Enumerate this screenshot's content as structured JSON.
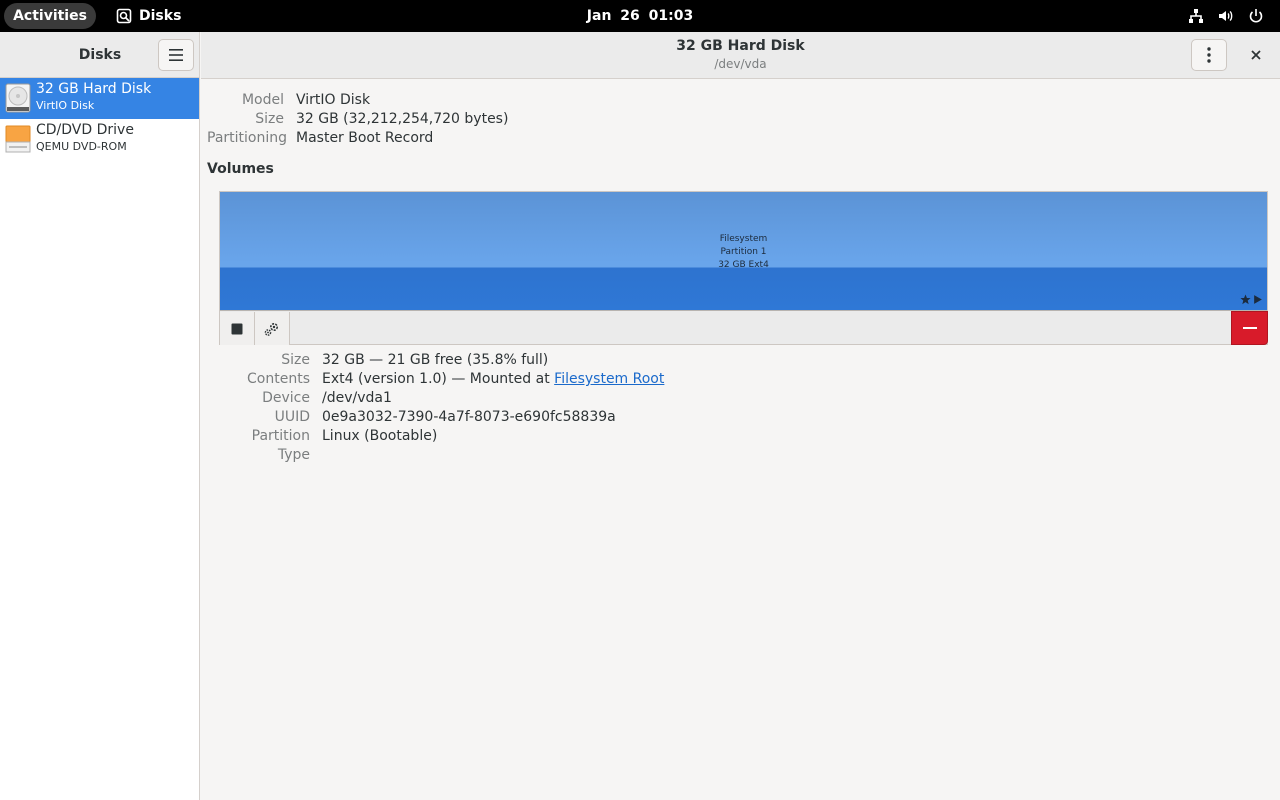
{
  "topbar": {
    "activities": "Activities",
    "app_name": "Disks",
    "clock": "Jan 26  01:03"
  },
  "sidebar": {
    "title": "Disks",
    "disks": [
      {
        "name": "32 GB Hard Disk",
        "sub": "VirtIO Disk"
      },
      {
        "name": "CD/DVD Drive",
        "sub": "QEMU DVD-ROM"
      }
    ]
  },
  "header": {
    "title": "32 GB Hard Disk",
    "subtitle": "/dev/vda"
  },
  "disk_info": {
    "model_label": "Model",
    "model": "VirtIO Disk",
    "size_label": "Size",
    "size": "32 GB (32,212,254,720 bytes)",
    "partitioning_label": "Partitioning",
    "partitioning": "Master Boot Record"
  },
  "volumes": {
    "label": "Volumes",
    "partition": {
      "line1": "Filesystem",
      "line2": "Partition 1",
      "line3": "32 GB Ext4"
    }
  },
  "volume_info": {
    "size_label": "Size",
    "size": "32 GB — 21 GB free (35.8% full)",
    "contents_label": "Contents",
    "contents_prefix": "Ext4 (version 1.0) — Mounted at ",
    "contents_link": "Filesystem Root",
    "device_label": "Device",
    "device": "/dev/vda1",
    "uuid_label": "UUID",
    "uuid": "0e9a3032-7390-4a7f-8073-e690fc58839a",
    "ptype_label": "Partition Type",
    "ptype": "Linux (Bootable)"
  },
  "colors": {
    "accent": "#3584e4",
    "danger": "#d81b2a",
    "partition_blue": "#69a5eb"
  }
}
